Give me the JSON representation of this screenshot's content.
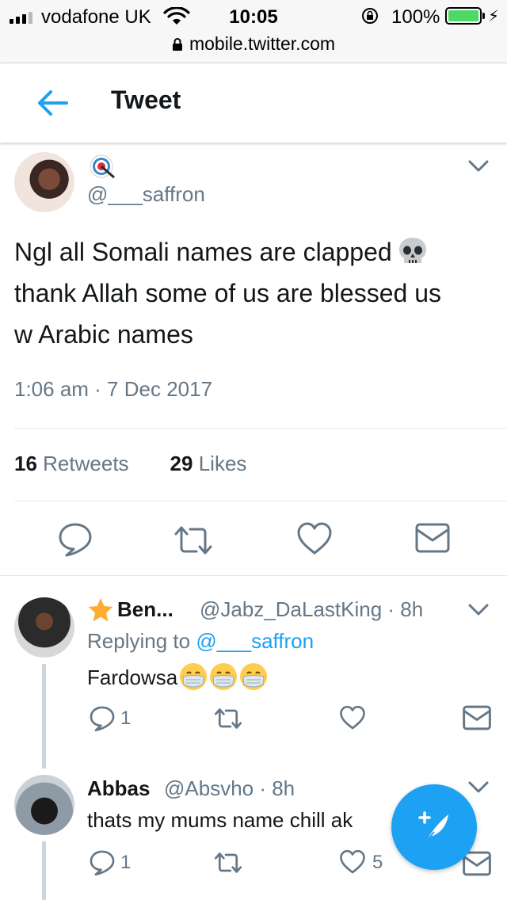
{
  "status_bar": {
    "carrier": "vodafone UK",
    "time": "10:05",
    "battery_percent": "100%",
    "url": "mobile.twitter.com"
  },
  "header": {
    "title": "Tweet"
  },
  "main_tweet": {
    "handle": "@___saffron",
    "text_line1": "Ngl all Somali names are clapped",
    "text_line2": "thank Allah some of us are blessed us",
    "text_line3": "w Arabic names",
    "timestamp": "1:06 am · 7 Dec 2017",
    "retweets_count": "16",
    "retweets_label": "Retweets",
    "likes_count": "29",
    "likes_label": "Likes"
  },
  "replies": [
    {
      "name": "Ben...",
      "handle_time": "@Jabz_DaLastKing · 8h",
      "replying_prefix": "Replying to",
      "replying_handle": "@___saffron",
      "text": "Fardowsa",
      "reply_count": "1",
      "retweet_count": "",
      "like_count": ""
    },
    {
      "name": "Abbas",
      "handle_time": "@Absvho · 8h",
      "text": "thats my mums name chill ak",
      "reply_count": "1",
      "retweet_count": "",
      "like_count": "5"
    }
  ],
  "colors": {
    "accent": "#1da1f2",
    "secondary_text": "#657786",
    "primary_text": "#14171a",
    "divider": "#e1e8ed"
  },
  "icons": [
    "back-arrow-icon",
    "direct-hit-emoji",
    "chevron-down-icon",
    "skull-emoji",
    "reply-icon",
    "retweet-icon",
    "heart-icon",
    "mail-icon",
    "star-emoji",
    "face-mask-emoji",
    "compose-icon",
    "lock-icon",
    "wifi-icon"
  ]
}
